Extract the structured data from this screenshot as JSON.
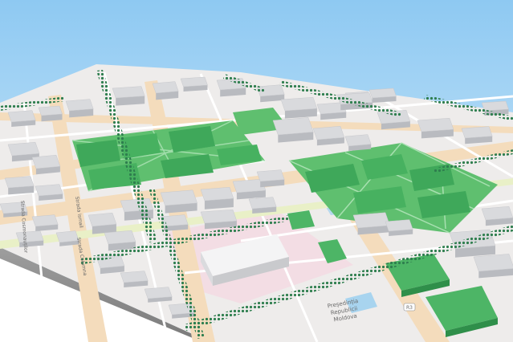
{
  "map": {
    "view": "3d-perspective",
    "colors": {
      "sky_top": "#8ec9f2",
      "sky_bottom": "#e6f3fc",
      "ground": "#eeeceb",
      "park": "#5fbf6f",
      "park_building": "#3fa85a",
      "building_top": "#d9dadd",
      "building_side": "#b9bbc0",
      "major_road": "#f4dcbc",
      "minor_road": "#ffffff",
      "tram_road": "#e9f0c7",
      "tree": "#2e7e4e",
      "plaza": "#f3dde4",
      "water": "#a8d4ef"
    },
    "labels": {
      "street_1": "Strada Ismail",
      "street_2": "Strada Columna",
      "street_3": "Strada Cosmonauților",
      "route_badge": "R3",
      "government_1": "Președinția",
      "government_2": "Republicii",
      "government_3": "Moldova"
    }
  }
}
